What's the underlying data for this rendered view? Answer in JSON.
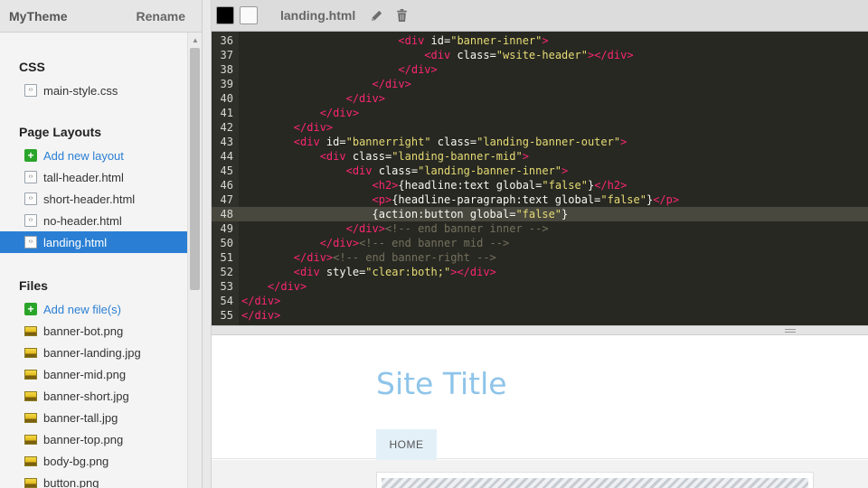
{
  "sidebar": {
    "theme_name": "MyTheme",
    "rename_label": "Rename",
    "sections": [
      {
        "title": "CSS",
        "items": [
          {
            "label": "main-style.css",
            "icon": "css-file-icon"
          }
        ]
      },
      {
        "title": "Page Layouts",
        "items": [
          {
            "label": "Add new layout",
            "icon": "plus-icon"
          },
          {
            "label": "tall-header.html",
            "icon": "html-file-icon"
          },
          {
            "label": "short-header.html",
            "icon": "html-file-icon"
          },
          {
            "label": "no-header.html",
            "icon": "html-file-icon"
          },
          {
            "label": "landing.html",
            "icon": "html-file-icon",
            "active": true
          }
        ]
      },
      {
        "title": "Files",
        "items": [
          {
            "label": "Add new file(s)",
            "icon": "plus-icon"
          },
          {
            "label": "banner-bot.png",
            "icon": "image-file-icon"
          },
          {
            "label": "banner-landing.jpg",
            "icon": "image-file-icon"
          },
          {
            "label": "banner-mid.png",
            "icon": "image-file-icon"
          },
          {
            "label": "banner-short.jpg",
            "icon": "image-file-icon"
          },
          {
            "label": "banner-tall.jpg",
            "icon": "image-file-icon"
          },
          {
            "label": "banner-top.png",
            "icon": "image-file-icon"
          },
          {
            "label": "body-bg.png",
            "icon": "image-file-icon"
          },
          {
            "label": "button.png",
            "icon": "image-file-icon"
          }
        ]
      }
    ]
  },
  "toolbar": {
    "file_name": "landing.html",
    "swatches": [
      {
        "name": "dark-theme-swatch",
        "color": "#000000"
      },
      {
        "name": "light-theme-swatch",
        "color": "#fafafa"
      }
    ],
    "edit_icon": "pencil-icon",
    "delete_icon": "trash-icon"
  },
  "editor": {
    "highlighted_line": 48,
    "lines": [
      {
        "n": "36",
        "code": "                        <div id=\"banner-inner\">"
      },
      {
        "n": "37",
        "code": "                            <div class=\"wsite-header\"></div>"
      },
      {
        "n": "38",
        "code": "                        </div>"
      },
      {
        "n": "39",
        "code": "                    </div>"
      },
      {
        "n": "40",
        "code": "                </div>"
      },
      {
        "n": "41",
        "code": "            </div>"
      },
      {
        "n": "42",
        "code": "        </div>"
      },
      {
        "n": "43",
        "code": "        <div id=\"bannerright\" class=\"landing-banner-outer\">"
      },
      {
        "n": "44",
        "code": "            <div class=\"landing-banner-mid\">"
      },
      {
        "n": "45",
        "code": "                <div class=\"landing-banner-inner\">"
      },
      {
        "n": "46",
        "code": "                    <h2>{headline:text global=\"false\"}</h2>"
      },
      {
        "n": "47",
        "code": "                    <p>{headline-paragraph:text global=\"false\"}</p>"
      },
      {
        "n": "48",
        "code": "                    {action:button global=\"false\"}"
      },
      {
        "n": "49",
        "code": "                </div><!-- end banner inner -->"
      },
      {
        "n": "50",
        "code": "            </div><!-- end banner mid -->"
      },
      {
        "n": "51",
        "code": "        </div><!-- end banner-right -->"
      },
      {
        "n": "52",
        "code": "        <div style=\"clear:both;\"></div>"
      },
      {
        "n": "53",
        "code": "    </div>"
      },
      {
        "n": "54",
        "code": "</div>"
      },
      {
        "n": "55",
        "code": "</div>"
      }
    ]
  },
  "preview": {
    "site_title": "Site Title",
    "nav_items": [
      "HOME"
    ]
  },
  "colors": {
    "active_item": "#2a7fd4",
    "site_title": "#8ec4ea",
    "editor_bg": "#272822"
  }
}
